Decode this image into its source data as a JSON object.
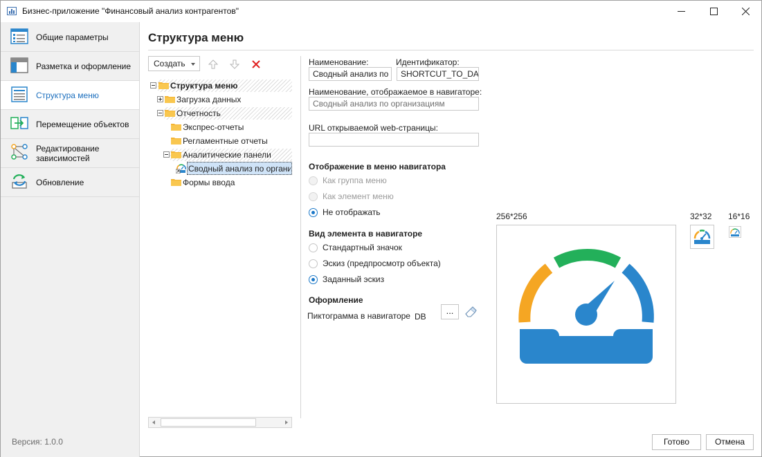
{
  "window": {
    "title": "Бизнес-приложение \"Финансовый анализ контрагентов\""
  },
  "sidebar": {
    "items": [
      {
        "label": "Общие параметры",
        "icon": "general-settings-icon"
      },
      {
        "label": "Разметка и оформление",
        "icon": "layout-icon"
      },
      {
        "label": "Структура меню",
        "icon": "menu-structure-icon",
        "active": true
      },
      {
        "label": "Перемещение объектов",
        "icon": "move-objects-icon"
      },
      {
        "label": "Редактирование зависимостей",
        "icon": "dependencies-icon"
      },
      {
        "label": "Обновление",
        "icon": "refresh-icon"
      }
    ],
    "version": "Версия: 1.0.0"
  },
  "main": {
    "title": "Структура меню",
    "toolbar": {
      "create_label": "Создать",
      "icons": [
        "arrow-up-icon",
        "arrow-down-icon",
        "delete-icon"
      ]
    },
    "tree": {
      "root": "Структура меню",
      "load": "Загрузка данных",
      "reports": "Отчетность",
      "express": "Экспрес-отчеты",
      "regulatory": "Регламентные отчеты",
      "panels": "Аналитические панели",
      "summary": "Сводный анализ по организациям",
      "forms": "Формы ввода"
    }
  },
  "form": {
    "name_label": "Наименование:",
    "name_value": "Сводный анализ по организациям",
    "id_label": "Идентификатор:",
    "id_value": "SHORTCUT_TO_DASHBOARD",
    "nav_name_label": "Наименование, отображаемое в навигаторе:",
    "nav_name_placeholder": "Сводный анализ по организациям",
    "url_label": "URL открываемой web-страницы:",
    "url_value": "",
    "nav_display_section": "Отображение в меню навигатора",
    "nav_display_options": [
      "Как группа меню",
      "Как элемент меню",
      "Не отображать"
    ],
    "nav_display_selected": 2,
    "view_section": "Вид элемента в навигаторе",
    "view_options": [
      "Стандартный значок",
      "Эскиз (предпросмотр объекта)",
      "Заданный эскиз"
    ],
    "view_selected": 2,
    "design_section": "Оформление",
    "icon_label": "Пиктограмма в навигаторе",
    "icon_value": "DB",
    "browse_label": "...",
    "preview_sizes": [
      "256*256",
      "32*32",
      "16*16"
    ]
  },
  "colors": {
    "accent": "#1c6fbe",
    "gauge_blue": "#2a86cc",
    "gauge_green": "#23b05a",
    "gauge_orange": "#f5a623"
  },
  "buttons": {
    "ok": "Готово",
    "cancel": "Отмена"
  }
}
